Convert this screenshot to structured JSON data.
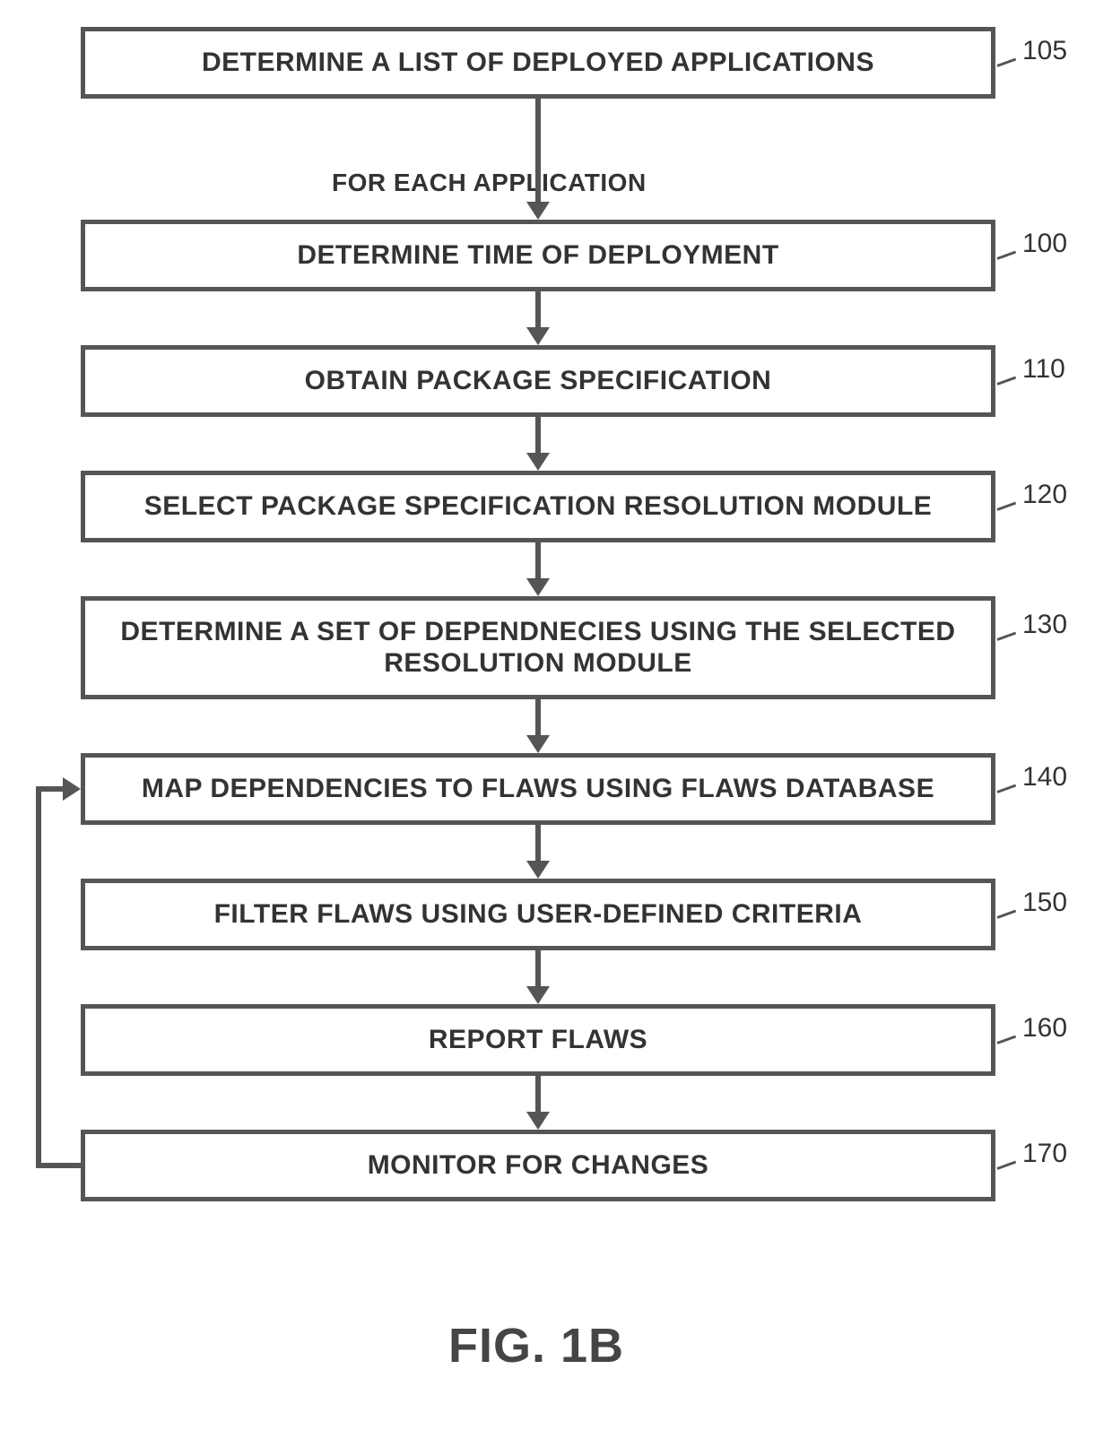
{
  "figure_caption": "FIG. 1B",
  "edge_label": "FOR EACH APPLICATION",
  "steps": [
    {
      "ref": "105",
      "text": "DETERMINE A LIST OF DEPLOYED APPLICATIONS"
    },
    {
      "ref": "100",
      "text": "DETERMINE TIME OF DEPLOYMENT"
    },
    {
      "ref": "110",
      "text": "OBTAIN PACKAGE SPECIFICATION"
    },
    {
      "ref": "120",
      "text": "SELECT PACKAGE SPECIFICATION RESOLUTION MODULE"
    },
    {
      "ref": "130",
      "text": "DETERMINE A SET OF DEPENDNECIES USING THE SELECTED RESOLUTION MODULE"
    },
    {
      "ref": "140",
      "text": "MAP DEPENDENCIES TO FLAWS USING FLAWS DATABASE"
    },
    {
      "ref": "150",
      "text": "FILTER FLAWS USING USER-DEFINED CRITERIA"
    },
    {
      "ref": "160",
      "text": "REPORT FLAWS"
    },
    {
      "ref": "170",
      "text": "MONITOR FOR CHANGES"
    }
  ],
  "feedback_edge": {
    "from_ref": "170",
    "to_ref": "140"
  }
}
